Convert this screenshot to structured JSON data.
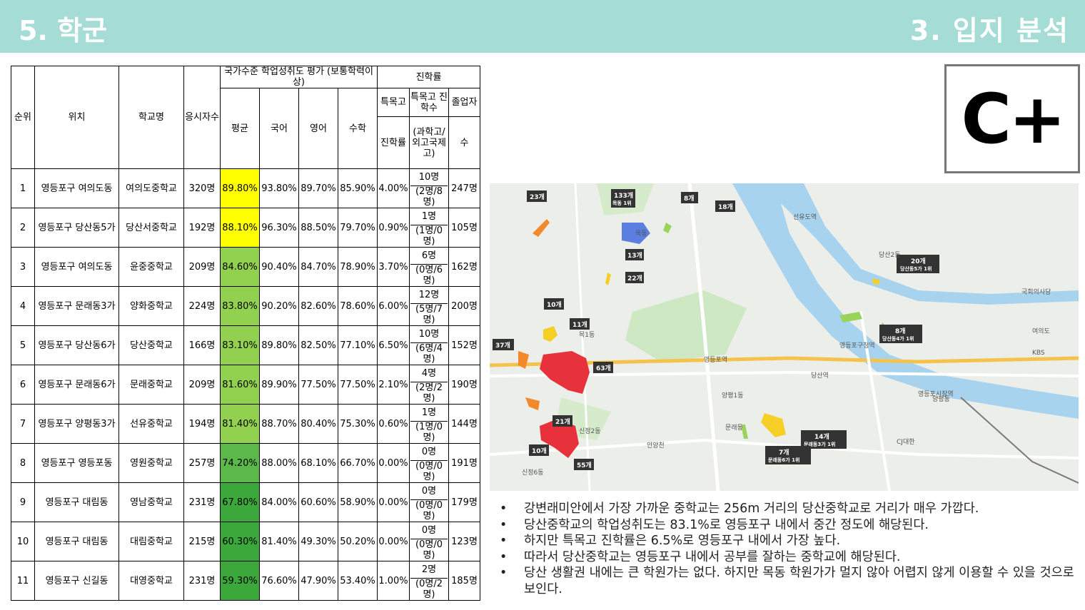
{
  "header": {
    "section_left": "5. 학군",
    "section_right": "3. 입지 분석"
  },
  "table": {
    "headers": {
      "rank": "순위",
      "location": "위치",
      "school": "학교명",
      "applicants": "응시자수",
      "achievement_group": "국가수준 학업성취도 평가 (보통학력이상)",
      "average": "평균",
      "korean": "국어",
      "english": "영어",
      "math": "수학",
      "advancement_group": "진학률",
      "special_rate_top": "특목고",
      "special_rate_bottom": "진학률",
      "special_count_top": "특목고 진학수",
      "special_count_bottom": "(과학고/외고국제고)",
      "graduates_top": "졸업자",
      "graduates_bottom": "수"
    },
    "rows": [
      {
        "rank": "1",
        "location": "영등포구 여의도동",
        "school": "여의도중학교",
        "applicants": "320명",
        "average": "89.80%",
        "korean": "93.80%",
        "english": "89.70%",
        "math": "85.90%",
        "special_rate": "4.00%",
        "special_count": "10명",
        "special_detail": "(2명/8명)",
        "graduates": "247명"
      },
      {
        "rank": "2",
        "location": "영등포구 당산동5가",
        "school": "당산서중학교",
        "applicants": "192명",
        "average": "88.10%",
        "korean": "96.30%",
        "english": "88.50%",
        "math": "79.70%",
        "special_rate": "0.90%",
        "special_count": "1명",
        "special_detail": "(1명/0명)",
        "graduates": "105명"
      },
      {
        "rank": "3",
        "location": "영등포구 여의도동",
        "school": "윤중중학교",
        "applicants": "209명",
        "average": "84.60%",
        "korean": "90.40%",
        "english": "84.70%",
        "math": "78.90%",
        "special_rate": "3.70%",
        "special_count": "6명",
        "special_detail": "(0명/6명)",
        "graduates": "162명"
      },
      {
        "rank": "4",
        "location": "영등포구 문래동3가",
        "school": "양화중학교",
        "applicants": "224명",
        "average": "83.80%",
        "korean": "90.20%",
        "english": "82.60%",
        "math": "78.60%",
        "special_rate": "6.00%",
        "special_count": "12명",
        "special_detail": "(5명/7명)",
        "graduates": "200명"
      },
      {
        "rank": "5",
        "location": "영등포구 당산동6가",
        "school": "당산중학교",
        "applicants": "166명",
        "average": "83.10%",
        "korean": "89.80%",
        "english": "82.50%",
        "math": "77.10%",
        "special_rate": "6.50%",
        "special_count": "10명",
        "special_detail": "(6명/4명)",
        "graduates": "152명"
      },
      {
        "rank": "6",
        "location": "영등포구 문래동6가",
        "school": "문래중학교",
        "applicants": "209명",
        "average": "81.60%",
        "korean": "89.90%",
        "english": "77.50%",
        "math": "77.50%",
        "special_rate": "2.10%",
        "special_count": "4명",
        "special_detail": "(2명/2명)",
        "graduates": "190명"
      },
      {
        "rank": "7",
        "location": "영등포구 양평동3가",
        "school": "선유중학교",
        "applicants": "194명",
        "average": "81.40%",
        "korean": "88.70%",
        "english": "80.40%",
        "math": "75.30%",
        "special_rate": "0.60%",
        "special_count": "1명",
        "special_detail": "(1명/0명)",
        "graduates": "144명"
      },
      {
        "rank": "8",
        "location": "영등포구 영등포동",
        "school": "영원중학교",
        "applicants": "257명",
        "average": "74.20%",
        "korean": "88.00%",
        "english": "68.10%",
        "math": "66.70%",
        "special_rate": "0.00%",
        "special_count": "0명",
        "special_detail": "(0명/0명)",
        "graduates": "191명"
      },
      {
        "rank": "9",
        "location": "영등포구 대림동",
        "school": "영남중학교",
        "applicants": "231명",
        "average": "67.80%",
        "korean": "84.00%",
        "english": "60.60%",
        "math": "58.90%",
        "special_rate": "0.00%",
        "special_count": "0명",
        "special_detail": "(0명/0명)",
        "graduates": "179명"
      },
      {
        "rank": "10",
        "location": "영등포구 대림동",
        "school": "대림중학교",
        "applicants": "215명",
        "average": "60.30%",
        "korean": "81.40%",
        "english": "49.30%",
        "math": "50.20%",
        "special_rate": "0.00%",
        "special_count": "0명",
        "special_detail": "(0명/0명)",
        "graduates": "123명"
      },
      {
        "rank": "11",
        "location": "영등포구 신길동",
        "school": "대영중학교",
        "applicants": "231명",
        "average": "59.30%",
        "korean": "76.60%",
        "english": "47.90%",
        "math": "53.40%",
        "special_rate": "1.00%",
        "special_count": "2명",
        "special_detail": "(0명/2명)",
        "graduates": "185명"
      }
    ]
  },
  "grade": "C+",
  "map": {
    "academy_counts": [
      "23개",
      "133개",
      "8개",
      "18개",
      "13개",
      "22개",
      "20개",
      "10개",
      "11개",
      "37개",
      "63개",
      "8개",
      "21개",
      "10개",
      "55개",
      "14개",
      "7개"
    ],
    "place_labels": [
      "목동 1위",
      "당산동5가 1위",
      "당산동4가 1위",
      "문래동3가 1위",
      "문래동6가 1위",
      "목동",
      "영등포역",
      "양평동",
      "당산역",
      "여의도",
      "영등포시장역",
      "신정2동",
      "목1동",
      "신정6동",
      "선유도역",
      "국회의사당",
      "영등포구청역",
      "안양천",
      "양평1동",
      "문래동",
      "KBS",
      "CJ대한",
      "당산2동"
    ]
  },
  "bullets": [
    "강변래미안에서 가장 가까운 중학교는 256m 거리의 당산중학교로 거리가 매우 가깝다.",
    "당산중학교의 학업성취도는 83.1%로 영등포구 내에서 중간 정도에 해당된다.",
    "하지만 특목고 진학률은 6.5%로 영등포구 내에서 가장 높다.",
    "따라서 당산중학교는 영등포구 내에서 공부를 잘하는 중학교에 해당된다.",
    "당산 생활권 내에는 큰 학원가는 없다. 하지만 목동 학원가가 멀지 않아 어렵지 않게 이용할 수 있을 것으로 보인다."
  ]
}
